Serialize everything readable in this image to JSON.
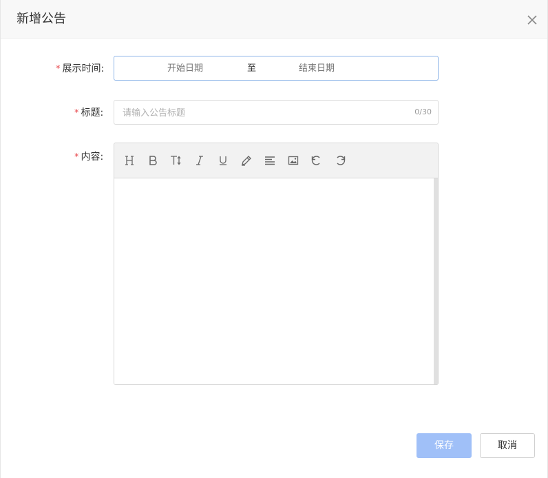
{
  "dialog": {
    "title": "新增公告",
    "close_icon": "close-icon"
  },
  "form": {
    "display_time": {
      "required_mark": "*",
      "label": "展示时间:",
      "start_placeholder": "开始日期",
      "separator": "至",
      "end_placeholder": "结束日期"
    },
    "title": {
      "required_mark": "*",
      "label": "标题:",
      "placeholder": "请输入公告标题",
      "value": "",
      "counter": "0/30"
    },
    "content": {
      "required_mark": "*",
      "label": "内容:",
      "toolbar": [
        "heading-icon",
        "bold-icon",
        "font-size-icon",
        "italic-icon",
        "underline-icon",
        "pen-icon",
        "align-icon",
        "image-icon",
        "undo-icon",
        "redo-icon"
      ]
    }
  },
  "footer": {
    "save_label": "保存",
    "cancel_label": "取消"
  },
  "colors": {
    "primary_disabled": "#a0c0f8",
    "required": "#e8474c",
    "focus_border": "#8db4e8"
  }
}
